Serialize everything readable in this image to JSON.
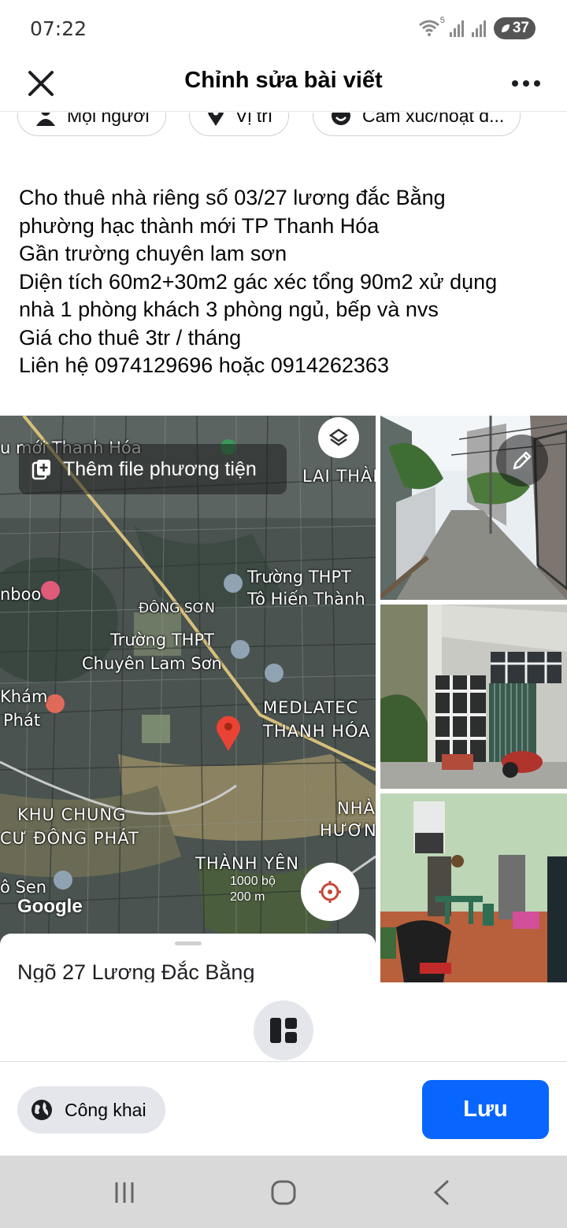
{
  "status_bar": {
    "time": "07:22",
    "wifi_badge": "5",
    "battery": "37",
    "icons": [
      "wifi-icon",
      "signal-icon",
      "signal-icon",
      "battery-icon"
    ]
  },
  "header": {
    "title": "Chỉnh sửa bài viết",
    "close_icon": "close-icon",
    "more_icon": "more-icon"
  },
  "chips": [
    {
      "label": "Mọi người",
      "icon": "people-icon"
    },
    {
      "label": "Vị trí",
      "icon": "location-pin-icon"
    },
    {
      "label": "Cảm xúc/hoạt đ...",
      "icon": "emoji-icon"
    }
  ],
  "post": {
    "lines": [
      "Cho thuê nhà riêng số 03/27 lương đắc Bằng",
      "phường hạc thành mới TP Thanh Hóa",
      "Gần trường chuyên lam sơn",
      "Diện tích 60m2+30m2 gác xéc tổng 90m2 xử dụng",
      "nhà 1 phòng khách 3 phòng ngủ, bếp và nvs",
      "Giá cho thuê 3tr / tháng",
      "Liên hệ 0974129696 hoặc 0914262363"
    ]
  },
  "media": {
    "add_media_label": "Thêm file phương tiện",
    "map": {
      "labels": {
        "top_left": "u mới Thanh Hóa",
        "lai_thanh": "LAI THÀNH",
        "truong_thpt_1a": "Trường THPT",
        "truong_thpt_1b": "Tô Hiến Thành",
        "nboo": "nboo",
        "dong_son": "ĐÔNG SƠN",
        "truong_thpt_2a": "Trường THPT",
        "truong_thpt_2b": "Chuyên Lam Sơn",
        "kham_a": "Khám",
        "kham_b": "Phát",
        "medlatec_a": "MEDLATEC",
        "medlatec_b": "THANH HÓA",
        "khu_chung_a": "KHU CHUNG",
        "khu_chung_b": "CƯ ĐÔNG PHÁT",
        "nha_a": "NHÀ",
        "nha_b": "HƯƠN",
        "thanh_yen": "THÀNH YÊN",
        "o_sen": "ô Sen",
        "google": "Google",
        "scale_a": "1000 bộ",
        "scale_b": "200 m"
      },
      "address": "Ngõ 27 Lương Đắc Bằng"
    },
    "photos": [
      "alley-photo",
      "house-front-photo",
      "living-room-photo"
    ]
  },
  "footer": {
    "privacy_label": "Công khai",
    "save_label": "Lưu"
  },
  "nav": {
    "buttons": [
      "recent-apps-icon",
      "home-icon",
      "back-icon"
    ]
  },
  "colors": {
    "accent": "#0866ff",
    "chip_bg": "#e4e6eb",
    "nav_bg": "#d9d9d9"
  }
}
